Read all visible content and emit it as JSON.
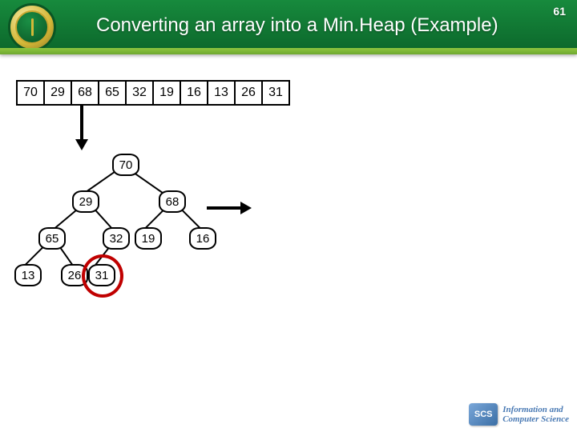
{
  "header": {
    "title": "Converting an array into a Min.Heap (Example)",
    "page_number": "61"
  },
  "array": [
    "70",
    "29",
    "68",
    "65",
    "32",
    "19",
    "16",
    "13",
    "26",
    "31"
  ],
  "tree": {
    "nodes": {
      "root": "70",
      "l": "29",
      "r": "68",
      "ll": "65",
      "lr": "32",
      "rl": "19",
      "rr": "16",
      "lll": "13",
      "llr": "26",
      "lrl": "31"
    }
  },
  "highlight_node": "lrl",
  "footer": {
    "scs": "SCS",
    "dept_line1": "Information and",
    "dept_line2": "Computer Science"
  }
}
